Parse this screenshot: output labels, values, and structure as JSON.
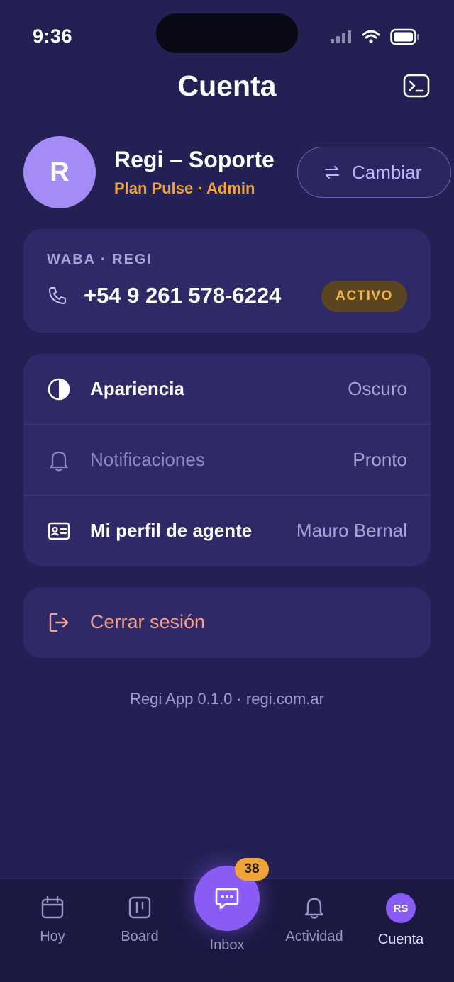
{
  "status_bar": {
    "time": "9:36"
  },
  "header": {
    "title": "Cuenta",
    "terminal_icon": "terminal-icon"
  },
  "profile": {
    "avatar_initial": "R",
    "name": "Regi – Soporte",
    "plan": "Plan Pulse · Admin",
    "switch_label": "Cambiar",
    "switch_icon": "swap-arrows-icon"
  },
  "waba": {
    "label": "WABA · REGI",
    "phone": "+54 9 261 578-6224",
    "status": "ACTIVO",
    "phone_icon": "phone-icon"
  },
  "settings": [
    {
      "label": "Apariencia",
      "value": "Oscuro",
      "icon": "contrast-icon"
    },
    {
      "label": "Notificaciones",
      "value": "Pronto",
      "icon": "bell-icon"
    },
    {
      "label": "Mi perfil de agente",
      "value": "Mauro Bernal",
      "icon": "id-card-icon"
    }
  ],
  "logout": {
    "label": "Cerrar sesión",
    "icon": "logout-icon"
  },
  "footer": {
    "version": "Regi App 0.1.0 · regi.com.ar"
  },
  "nav": {
    "items": [
      {
        "label": "Hoy",
        "icon": "calendar-icon"
      },
      {
        "label": "Board",
        "icon": "board-icon"
      },
      {
        "label": "Inbox",
        "icon": "chat-icon",
        "badge": "38"
      },
      {
        "label": "Actividad",
        "icon": "bell-icon"
      },
      {
        "label": "Cuenta",
        "avatar": "RS"
      }
    ]
  },
  "colors": {
    "background": "#232053",
    "card": "#2f2a67",
    "accent": "#8a5cf6",
    "plan": "#f2a23a",
    "logout": "#f0a092"
  }
}
